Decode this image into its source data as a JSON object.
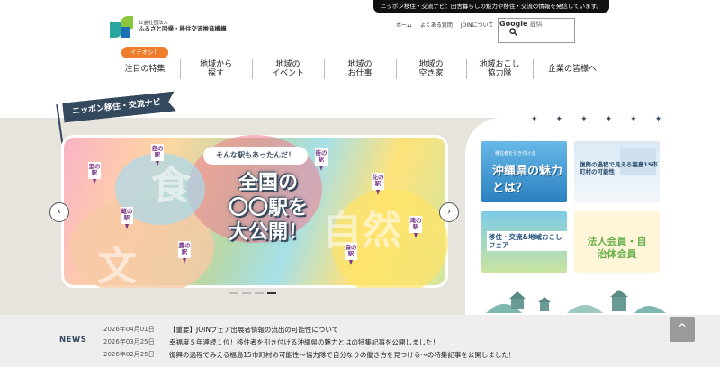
{
  "tagline": "ニッポン移住・交流ナビ：田舎暮らしの魅力や移住・交流の情報を発信しています。",
  "logo": {
    "sub": "公益社団法人",
    "main": "ふるさと回帰・移住交流推進機構"
  },
  "utility_links": [
    "ホーム",
    "よくある質問",
    "JOINについて"
  ],
  "search": {
    "google": "Google",
    "label": "提供"
  },
  "nav": {
    "badge": "イチオシ！",
    "items": [
      {
        "l1": "注目の特集",
        "l2": ""
      },
      {
        "l1": "地域から",
        "l2": "探す"
      },
      {
        "l1": "地域の",
        "l2": "イベント"
      },
      {
        "l1": "地域の",
        "l2": "お仕事"
      },
      {
        "l1": "地域の",
        "l2": "空き家"
      },
      {
        "l1": "地域おこし",
        "l2": "協力隊"
      },
      {
        "l1": "企業の皆様へ",
        "l2": ""
      }
    ]
  },
  "hero": {
    "ribbon": "ニッポン移住・交流ナビ",
    "pill": "そんな駅もあったんだ！",
    "title_l1": "全国の",
    "title_l2": "〇〇駅を",
    "title_l3": "大公開！",
    "big_words": [
      "食",
      "文",
      "自然"
    ],
    "stations": [
      "里の駅",
      "島の駅",
      "街の駅",
      "花の駅",
      "蔵の駅",
      "滝の駅",
      "森の駅",
      "農の駅"
    ],
    "prev": "‹",
    "next": "›"
  },
  "banners": [
    {
      "sub": "移住者を引き付ける",
      "title": "沖縄県の魅力とは？"
    },
    {
      "title": "復興の過程で見える福島15市町村の可能性"
    },
    {
      "title": "移住・交流&地域おこしフェア"
    },
    {
      "title": "法人会員・自治体会員"
    }
  ],
  "news": {
    "label": "NEWS",
    "items": [
      {
        "date": "2026年04月01日",
        "text": "【重要】JOINフェア出展者情報の流出の可能性について"
      },
      {
        "date": "2026年03月25日",
        "text": "幸福度５年連続１位！移住者を引き付ける沖縄県の魅力とはの特集記事を公開しました！"
      },
      {
        "date": "2026年02月25日",
        "text": "復興の過程でみえる福島15市町村の可能性〜協力隊で自分なりの働き方を見つける〜の特集記事を公開しました！"
      }
    ]
  },
  "back_to_top": "^"
}
